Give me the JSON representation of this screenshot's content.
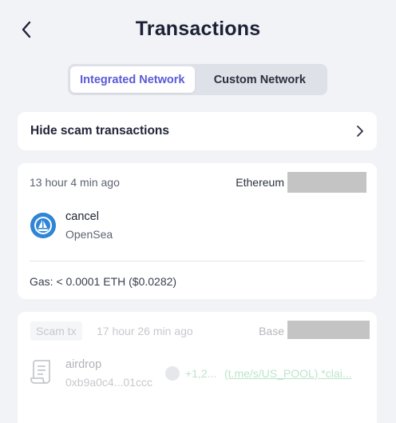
{
  "header": {
    "title": "Transactions",
    "back_icon": "chevron-left-icon"
  },
  "tabs": [
    {
      "label": "Integrated Network",
      "active": true
    },
    {
      "label": "Custom Network",
      "active": false
    }
  ],
  "scam_filter": {
    "label": "Hide scam transactions",
    "icon": "chevron-right-icon"
  },
  "transactions": [
    {
      "time": "13 hour 4 min ago",
      "network": "Ethereum",
      "icon": "opensea-icon",
      "title": "cancel",
      "subtitle": "OpenSea",
      "gas": "Gas: < 0.0001 ETH ($0.0282)"
    },
    {
      "badge": "Scam tx",
      "time": "17 hour 26 min ago",
      "network": "Base",
      "icon": "document-scroll-icon",
      "title": "airdrop",
      "subtitle": "0xb9a0c4...01ccc",
      "amount": "+1,2...",
      "link": "(t.me/s/US_POOL) *clai..."
    }
  ],
  "colors": {
    "accent": "#5a5ad6",
    "background": "#f2f3f7",
    "positive": "#3fb36a"
  }
}
